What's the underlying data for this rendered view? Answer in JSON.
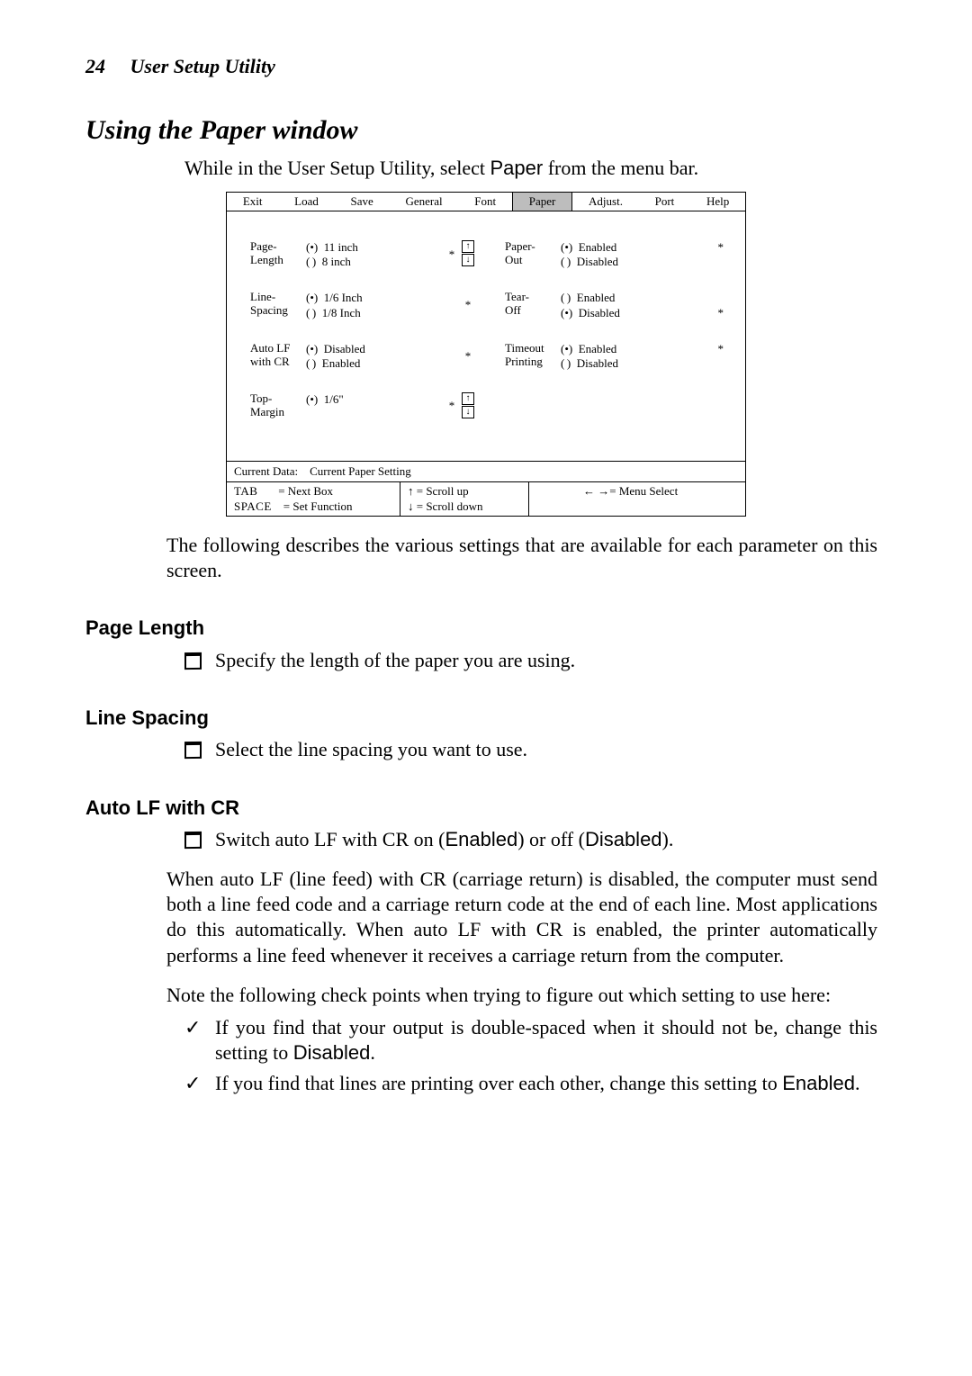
{
  "header": {
    "page": "24",
    "title": "User Setup Utility"
  },
  "h1": "Using the Paper window",
  "intro": {
    "pre": "While in the User Setup Utility, select ",
    "kw": "Paper",
    "post": " from the menu bar."
  },
  "app": {
    "menu": [
      "Exit",
      "Load",
      "Save",
      "General",
      "Font",
      "Paper",
      "Adjust.",
      "Port",
      "Help"
    ],
    "selected_menu_index": 5,
    "left": [
      {
        "label1": "Page-",
        "label2": "Length",
        "opts": [
          "11 inch",
          "8 inch"
        ],
        "sel": 0,
        "star": "*",
        "scroll": true
      },
      {
        "label1": "Line-",
        "label2": "Spacing",
        "opts": [
          "1/6 Inch",
          "1/8 Inch"
        ],
        "sel": 0,
        "star": "*",
        "scroll": false
      },
      {
        "label1": "Auto LF",
        "label2": "with CR",
        "opts": [
          "Disabled",
          "Enabled"
        ],
        "sel": 0,
        "star": "*",
        "scroll": false
      },
      {
        "label1": "Top-",
        "label2": "Margin",
        "opts": [
          "1/6\""
        ],
        "sel": 0,
        "star": "*",
        "scroll": true
      }
    ],
    "right": [
      {
        "label1": "Paper-",
        "label2": "Out",
        "opts": [
          "Enabled",
          "Disabled"
        ],
        "sel": 0,
        "star": "*",
        "starpos": 0
      },
      {
        "label1": "Tear-",
        "label2": "Off",
        "opts": [
          "Enabled",
          "Disabled"
        ],
        "sel": 1,
        "star": "*",
        "starpos": 1
      },
      {
        "label1": "Timeout",
        "label2": "Printing",
        "opts": [
          "Enabled",
          "Disabled"
        ],
        "sel": 0,
        "star": "*",
        "starpos": 0
      }
    ],
    "status1": {
      "label": "Current Data:",
      "value": "Current Paper Setting"
    },
    "status2": {
      "tab": {
        "k": "TAB",
        "v": "= Next Box"
      },
      "space": {
        "k": "SPACE",
        "v": "= Set Function"
      },
      "up": "= Scroll up",
      "down": "= Scroll down",
      "menu": "= Menu Select"
    }
  },
  "desc": "The following describes the various settings that are available for each parameter on this screen.",
  "sections": {
    "pageLength": {
      "h": "Page Length",
      "b1": "Specify the length of the paper you are using."
    },
    "lineSpacing": {
      "h": "Line Spacing",
      "b1": "Select the line spacing you want to use."
    },
    "autoLF": {
      "h": "Auto LF with CR",
      "b1_pre": "Switch auto LF with CR on (",
      "b1_en": "Enabled",
      "b1_mid": ") or off (",
      "b1_dis": "Disabled",
      "b1_post": ").",
      "p1": "When auto LF (line feed) with CR (carriage return) is disabled, the computer must send both a line feed code and a carriage return code at the end of each line. Most applications do this automatically. When auto LF with CR is enabled, the printer automatically performs a line feed whenever it receives a carriage return from the computer.",
      "p2": "Note the following check points when trying to figure out which setting to use here:",
      "c1_pre": "If you find that your output is double-spaced when it should not be, change this setting to ",
      "c1_kw": "Disabled",
      "c1_post": ".",
      "c2_pre": "If you find that lines are printing over each other, change this setting to ",
      "c2_kw": "Enabled",
      "c2_post": "."
    }
  }
}
